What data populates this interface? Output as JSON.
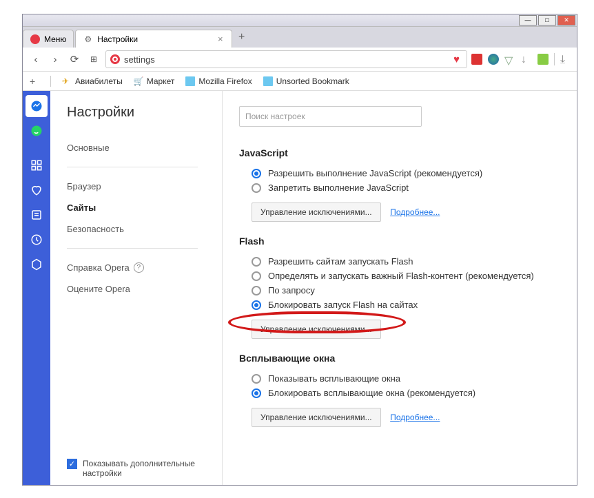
{
  "window": {
    "menu_label": "Меню",
    "tab_title": "Настройки"
  },
  "address": {
    "url_text": "settings"
  },
  "bookmarks": {
    "items": [
      "Авиабилеты",
      "Маркет",
      "Mozilla Firefox",
      "Unsorted Bookmark"
    ]
  },
  "sidebar": {
    "title": "Настройки",
    "items": [
      "Основные",
      "Браузер",
      "Сайты",
      "Безопасность"
    ],
    "help": "Справка Opera",
    "rate": "Оцените Opera",
    "advanced": "Показывать дополнительные настройки"
  },
  "search": {
    "placeholder": "Поиск настроек"
  },
  "sections": {
    "js": {
      "title": "JavaScript",
      "opt1": "Разрешить выполнение JavaScript (рекомендуется)",
      "opt2": "Запретить выполнение JavaScript",
      "manage": "Управление исключениями...",
      "more": "Подробнее..."
    },
    "flash": {
      "title": "Flash",
      "opt1": "Разрешить сайтам запускать Flash",
      "opt2": "Определять и запускать важный Flash-контент (рекомендуется)",
      "opt3": "По запросу",
      "opt4": "Блокировать запуск Flash на сайтах",
      "manage": "Управление исключениями..."
    },
    "popups": {
      "title": "Всплывающие окна",
      "opt1": "Показывать всплывающие окна",
      "opt2": "Блокировать всплывающие окна (рекомендуется)",
      "manage": "Управление исключениями...",
      "more": "Подробнее..."
    }
  }
}
